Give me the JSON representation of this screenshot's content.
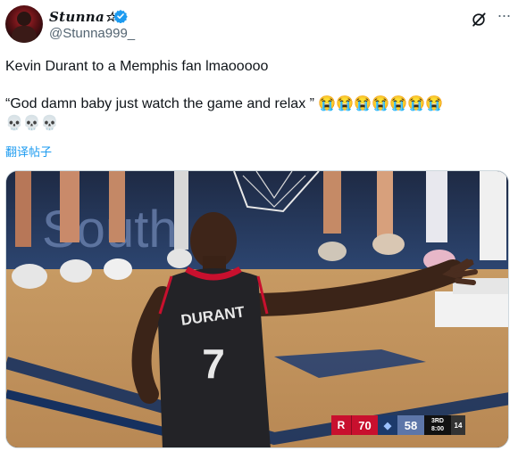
{
  "author": {
    "display_name": "Stunna☆",
    "handle": "@Stunna999_",
    "verified": true
  },
  "icons": {
    "verified": "verified-badge-icon",
    "grok": "grok-slash-icon",
    "more": "more-dots-icon"
  },
  "tweet": {
    "line1": "Kevin Durant to a Memphis fan lmaooooo",
    "line2": "“God damn baby just watch the game and relax ” 😭😭😭😭😭😭😭",
    "line3": "💀💀💀"
  },
  "translate_label": "翻译帖子",
  "media": {
    "jersey_name": "DURANT",
    "jersey_number": "7",
    "baseline_text": "South",
    "scorebug": {
      "home_score": "70",
      "away_score": "58",
      "period": "3RD",
      "clock": "8:00",
      "shot_clock": "14"
    }
  },
  "colors": {
    "accent_blue": "#1d9bf0",
    "rockets_red": "#c8102e",
    "grizzlies_blue": "#5d76a9"
  }
}
